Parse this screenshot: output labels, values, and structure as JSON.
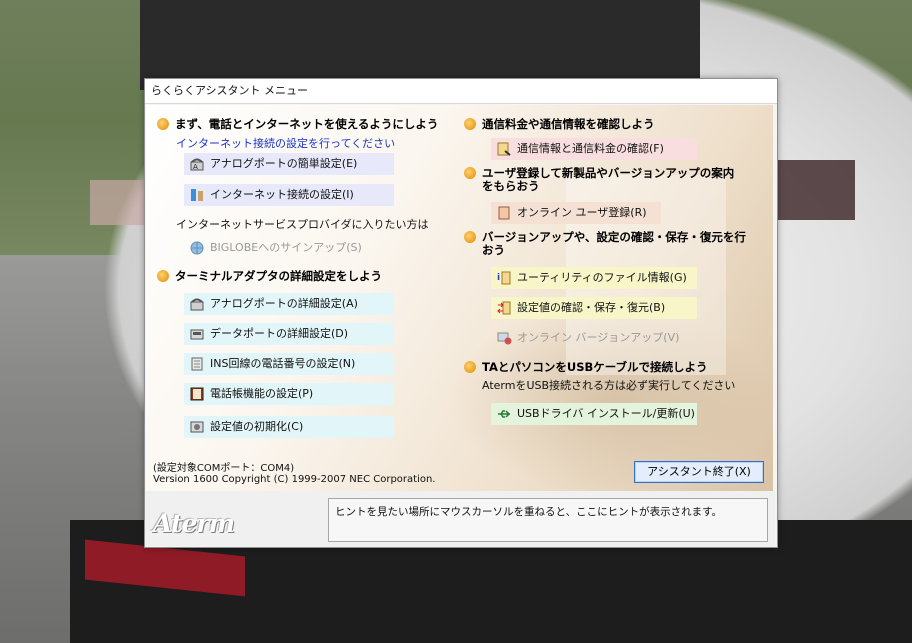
{
  "window": {
    "title": "らくらくアシスタント メニュー"
  },
  "left": {
    "section1": {
      "title": "まず、電話とインターネットを使えるようにしよう",
      "subtitle": "インターネット接続の設定を行ってください",
      "items": [
        {
          "label": "アナログポートの簡単設定(E)"
        },
        {
          "label": "インターネット接続の設定(I)"
        }
      ],
      "note": "インターネットサービスプロバイダに入りたい方は",
      "biglobe": "BIGLOBEへのサインアップ(S)"
    },
    "section2": {
      "title": "ターミナルアダプタの詳細設定をしよう",
      "items": [
        {
          "label": "アナログポートの詳細設定(A)"
        },
        {
          "label": "データポートの詳細設定(D)"
        },
        {
          "label": "INS回線の電話番号の設定(N)"
        },
        {
          "label": "電話帳機能の設定(P)"
        },
        {
          "label": "設定値の初期化(C)"
        }
      ]
    }
  },
  "right": {
    "section1": {
      "title": "通信料金や通信情報を確認しよう",
      "item": "通信情報と通信料金の確認(F)"
    },
    "section2": {
      "title_line1": "ユーザ登録して新製品やバージョンアップの案内",
      "title_line2": "をもらおう",
      "item": "オンライン ユーザ登録(R)"
    },
    "section3": {
      "title_line1": "バージョンアップや、設定の確認・保存・復元を行",
      "title_line2": "おう",
      "items": [
        {
          "label": "ユーティリティのファイル情報(G)"
        },
        {
          "label": "設定値の確認・保存・復元(B)"
        },
        {
          "label": "オンライン バージョンアップ(V)"
        }
      ]
    },
    "section4": {
      "title": "TAとパソコンをUSBケーブルで接続しよう",
      "subtitle": "AtermをUSB接続される方は必ず実行してください",
      "item": "USBドライバ インストール/更新(U)"
    }
  },
  "footer": {
    "port": "(設定対象COMポート：COM4)",
    "version": "Version 1600 Copyright (C) 1999-2007 NEC Corporation.",
    "end_button": "アシスタント終了(X)"
  },
  "bottom": {
    "logo": "Aterm",
    "hint": "ヒントを見たい場所にマウスカーソルを重ねると、ここにヒントが表示されます。"
  }
}
